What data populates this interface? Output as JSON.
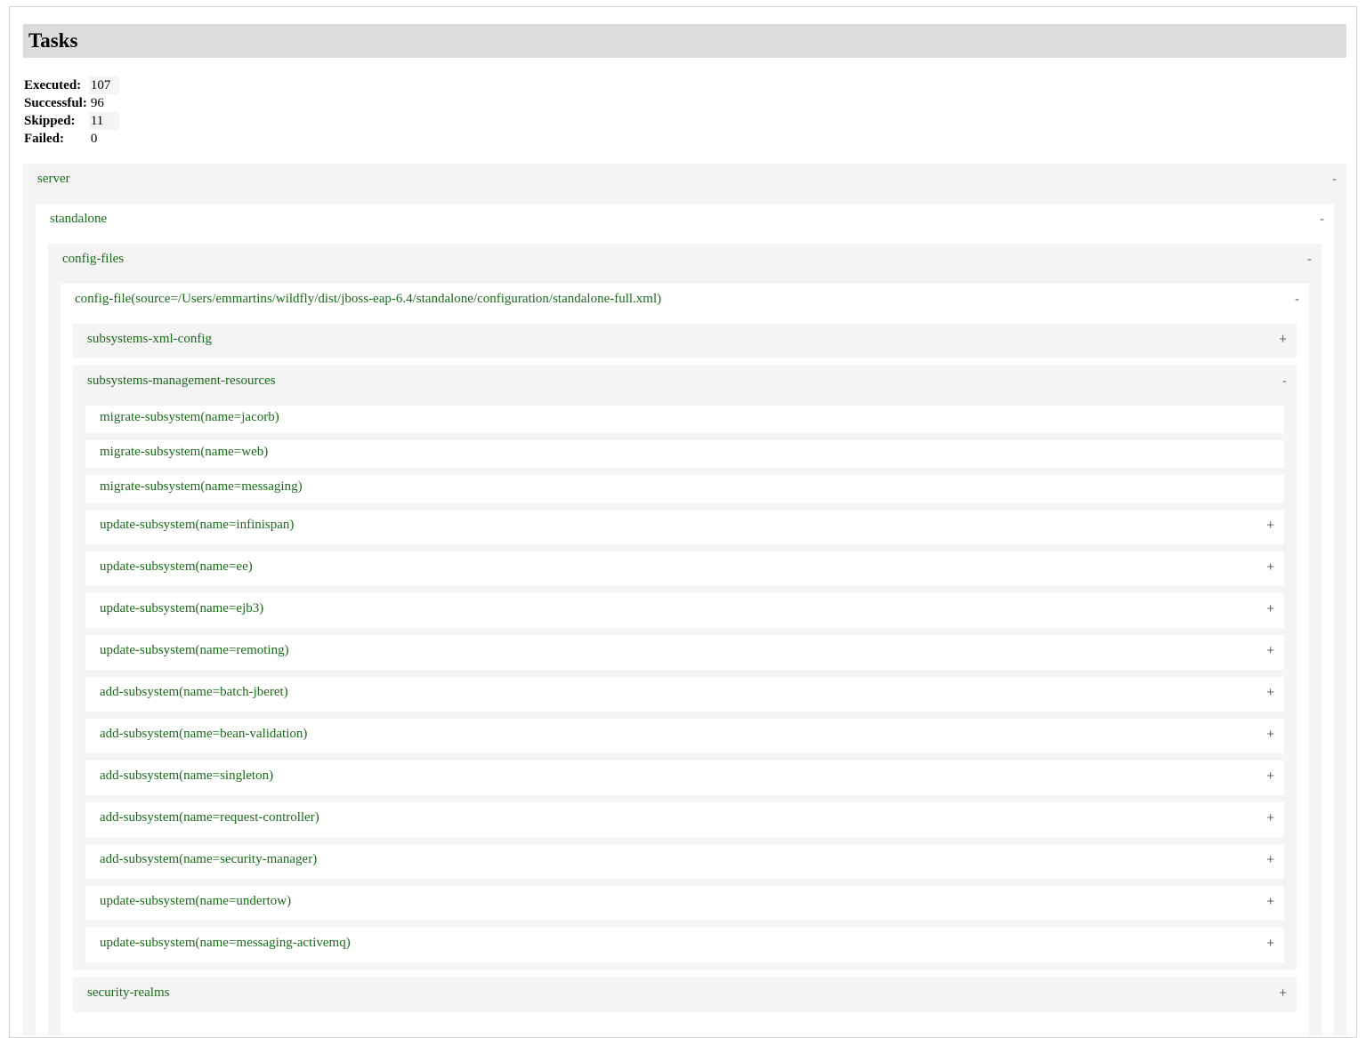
{
  "title": "Tasks",
  "summary": {
    "executed_label": "Executed:",
    "executed": "107",
    "successful_label": "Successful:",
    "successful": "96",
    "skipped_label": "Skipped:",
    "skipped": "11",
    "failed_label": "Failed:",
    "failed": "0"
  },
  "tree": {
    "server": {
      "label": "server",
      "toggle": "-"
    },
    "standalone": {
      "label": "standalone",
      "toggle": "-"
    },
    "config_files": {
      "label": "config-files",
      "toggle": "-"
    },
    "config_file": {
      "label": "config-file(source=/Users/emmartins/wildfly/dist/jboss-eap-6.4/standalone/configuration/standalone-full.xml)",
      "toggle": "-"
    },
    "subsystems_xml_config": {
      "label": "subsystems-xml-config",
      "toggle": "+"
    },
    "subsystems_mgmt": {
      "label": "subsystems-management-resources",
      "toggle": "-"
    },
    "tasks": [
      {
        "label": "migrate-subsystem(name=jacorb)",
        "toggle": ""
      },
      {
        "label": "migrate-subsystem(name=web)",
        "toggle": ""
      },
      {
        "label": "migrate-subsystem(name=messaging)",
        "toggle": ""
      },
      {
        "label": "update-subsystem(name=infinispan)",
        "toggle": "+"
      },
      {
        "label": "update-subsystem(name=ee)",
        "toggle": "+"
      },
      {
        "label": "update-subsystem(name=ejb3)",
        "toggle": "+"
      },
      {
        "label": "update-subsystem(name=remoting)",
        "toggle": "+"
      },
      {
        "label": "add-subsystem(name=batch-jberet)",
        "toggle": "+"
      },
      {
        "label": "add-subsystem(name=bean-validation)",
        "toggle": "+"
      },
      {
        "label": "add-subsystem(name=singleton)",
        "toggle": "+"
      },
      {
        "label": "add-subsystem(name=request-controller)",
        "toggle": "+"
      },
      {
        "label": "add-subsystem(name=security-manager)",
        "toggle": "+"
      },
      {
        "label": "update-subsystem(name=undertow)",
        "toggle": "+"
      },
      {
        "label": "update-subsystem(name=messaging-activemq)",
        "toggle": "+"
      }
    ],
    "security_realms": {
      "label": "security-realms",
      "toggle": "+"
    }
  }
}
